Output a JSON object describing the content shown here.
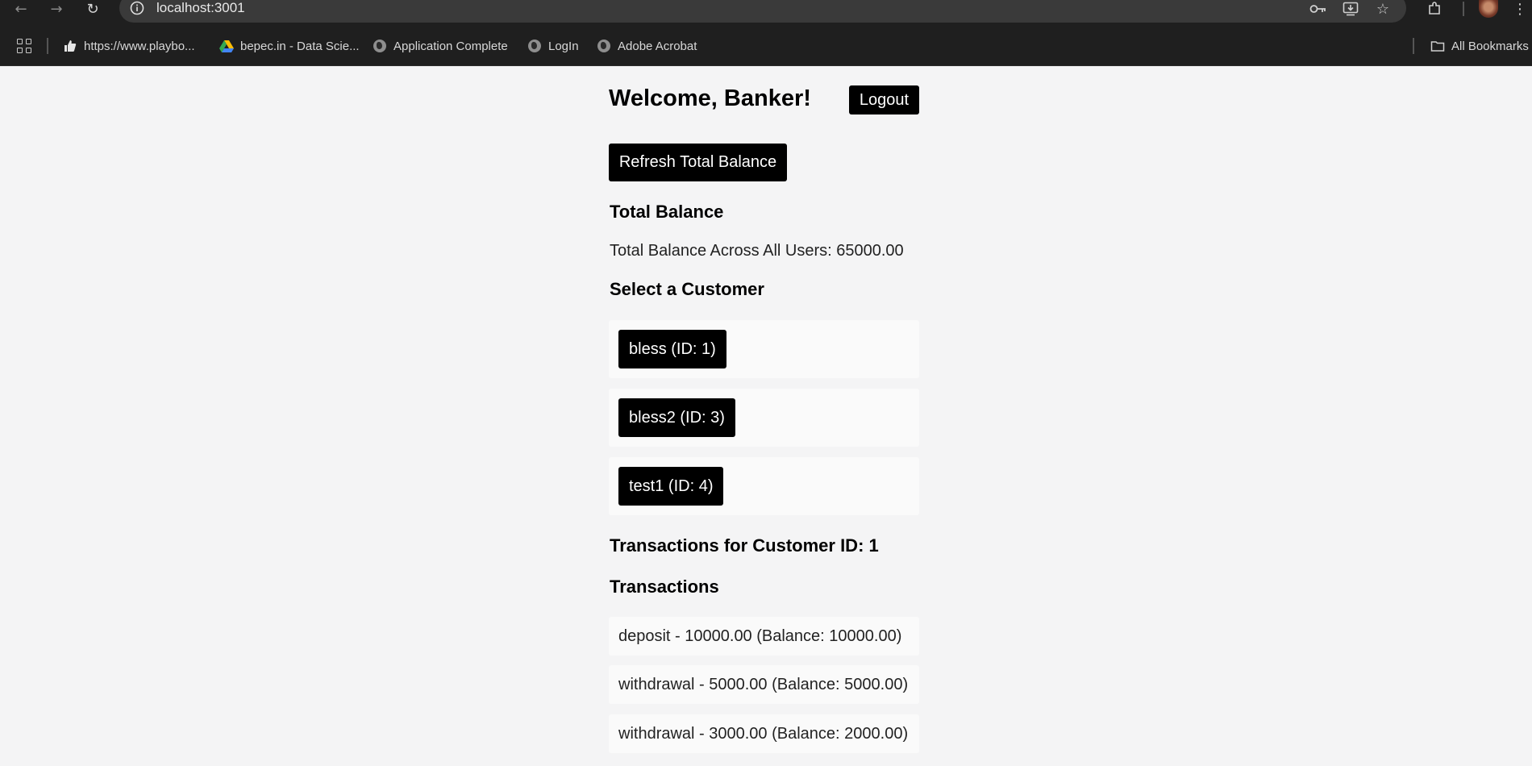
{
  "browser": {
    "url": "localhost:3001",
    "bookmarks": [
      {
        "label": "https://www.playbo...",
        "icon": "thumbs-up-icon"
      },
      {
        "label": "bepec.in - Data Scie...",
        "icon": "drive-icon"
      },
      {
        "label": "Application Complete",
        "icon": "globe-icon"
      },
      {
        "label": "LogIn",
        "icon": "globe-icon"
      },
      {
        "label": "Adobe Acrobat",
        "icon": "globe-icon"
      }
    ],
    "all_bookmarks_label": "All Bookmarks"
  },
  "header": {
    "welcome": "Welcome, Banker!",
    "logout_label": "Logout"
  },
  "refresh_label": "Refresh Total Balance",
  "total_balance": {
    "heading": "Total Balance",
    "text": "Total Balance Across All Users: 65000.00"
  },
  "customers": {
    "heading": "Select a Customer",
    "items": [
      {
        "label": "bless (ID: 1)"
      },
      {
        "label": "bless2 (ID: 3)"
      },
      {
        "label": "test1 (ID: 4)"
      }
    ]
  },
  "transactions": {
    "customer_heading": "Transactions for Customer ID: 1",
    "heading": "Transactions",
    "items": [
      {
        "text": "deposit - 10000.00 (Balance: 10000.00)"
      },
      {
        "text": "withdrawal - 5000.00 (Balance: 5000.00)"
      },
      {
        "text": "withdrawal - 3000.00 (Balance: 2000.00)"
      }
    ]
  }
}
